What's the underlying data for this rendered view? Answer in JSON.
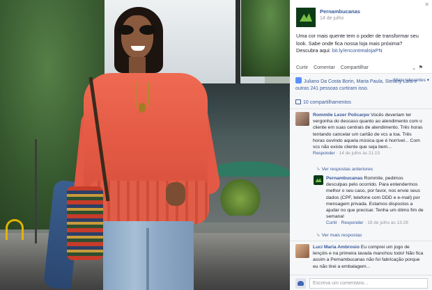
{
  "post": {
    "page_name": "Pernambucanas",
    "date": "14 de julho",
    "text": "Uma cor mais quente tem o poder de transformar seu look. Sabe onde fica nossa loja mais próxima? Descubra aqui:",
    "link": "bit.ly/encontrealojaPN",
    "actions": {
      "like": "Curtir",
      "comment": "Comentar",
      "share": "Compartilhar"
    }
  },
  "engagement": {
    "likes_text": "Juliano Da Costa Borin, Maria Paula, Stefany Lara e",
    "likes_count": "outras 241 pessoas curtiram isso.",
    "relevance": "Mais relevantes",
    "shares": "10 compartilhamentos"
  },
  "comments": [
    {
      "author": "Rommile Lezer Policarpo",
      "text": "Vocês deveriam ter vergonha do descaso quanto ao atendimento com o cliente em suas centrais de atendimento. Três horas tentando cancelar um cartão de vcs a toa. Três horas ouvindo aquela música que é horrível... Com vcs não existe cliente que seja bem...",
      "reply_link": "Responder",
      "time": "14 de julho às 21:15",
      "view_more": "Ver respostas anteriores",
      "reply": {
        "author": "Pernambucanas",
        "text": "Rommile, pedimos desculpas pelo ocorrido. Para entendermos melhor o seu caso, por favor, nos envie seus dados (CPF, telefone com DDD e e-mail) por mensagem privada. Estamos dispostos a ajudar no que precisar. Tenha um ótimo fim de semana!",
        "like_link": "Curtir",
        "reply_link": "Responder",
        "time": "18 de julho às 13:29"
      },
      "view_more_after": "Ver mais respostas"
    },
    {
      "author": "Luci Maria Ambrosio",
      "text": "Eu comprei um jogo de lençóis e na primeira lavada manchou todo! Não fica assim a Pernambucanas não foi fabricação porque eu não tirei a embalagem..."
    }
  ],
  "write_comment": {
    "placeholder": "Escreva um comentário..."
  },
  "icons": {
    "close": "close-icon",
    "more": "chevron-down-icon",
    "flag": "flag-icon"
  },
  "colors": {
    "link": "#365899",
    "accent_green": "#76c043",
    "blouse": "#e45a44"
  }
}
